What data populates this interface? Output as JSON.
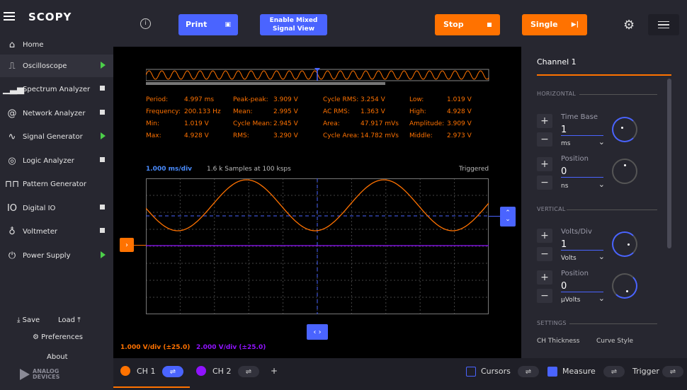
{
  "app": {
    "brand": "SCOPY",
    "footer_logo": "ANALOG\nDEVICES"
  },
  "sidebar": {
    "home": "Home",
    "items": [
      {
        "label": "Oscilloscope",
        "status": "running"
      },
      {
        "label": "Spectrum Analyzer",
        "status": "stopped"
      },
      {
        "label": "Network Analyzer",
        "status": "stopped"
      },
      {
        "label": "Signal Generator",
        "status": "running"
      },
      {
        "label": "Logic Analyzer",
        "status": "stopped"
      },
      {
        "label": "Pattern Generator",
        "status": "none"
      },
      {
        "label": "Digital IO",
        "status": "stopped"
      },
      {
        "label": "Voltmeter",
        "status": "stopped"
      },
      {
        "label": "Power Supply",
        "status": "running"
      }
    ],
    "save": "Save",
    "load": "Load",
    "preferences": "Preferences",
    "about": "About"
  },
  "toolbar": {
    "print": "Print",
    "mixed_view_line1": "Enable Mixed",
    "mixed_view_line2": "Signal View",
    "stop": "Stop",
    "single": "Single"
  },
  "measurements": [
    [
      "Period:",
      "4.997 ms",
      "Peak-peak:",
      "3.909 V",
      "Cycle RMS:",
      "3.254 V",
      "Low:",
      "1.019 V"
    ],
    [
      "Frequency:",
      "200.133 Hz",
      "Mean:",
      "2.995 V",
      "AC RMS:",
      "1.363 V",
      "High:",
      "4.928 V"
    ],
    [
      "Min:",
      "1.019 V",
      "Cycle Mean:",
      "2.945 V",
      "Area:",
      "47.917 mVs",
      "Amplitude:",
      "3.909 V"
    ],
    [
      "Max:",
      "4.928 V",
      "RMS:",
      "3.290 V",
      "Cycle Area:",
      "14.782 mVs",
      "Middle:",
      "2.973 V"
    ]
  ],
  "plot": {
    "time_div": "1.000 ms/div",
    "samples": "1.6 k Samples at 100 ksps",
    "status": "Triggered",
    "ch1_scale": "1.000 V/div (±25.0)",
    "ch2_scale": "2.000 V/div (±25.0)"
  },
  "panel": {
    "title": "Channel 1",
    "horizontal": "HORIZONTAL",
    "timebase_label": "Time Base",
    "timebase_value": "1",
    "timebase_unit": "ms",
    "hpos_label": "Position",
    "hpos_value": "0",
    "hpos_unit": "ns",
    "vertical": "VERTICAL",
    "vdiv_label": "Volts/Div",
    "vdiv_value": "1",
    "vdiv_unit": "Volts",
    "vpos_label": "Position",
    "vpos_value": "0",
    "vpos_unit": "μVolts",
    "settings": "SETTINGS",
    "ch_thickness": "CH Thickness",
    "curve_style": "Curve Style"
  },
  "bottom": {
    "ch1": "CH 1",
    "ch2": "CH 2",
    "add": "+",
    "cursors": "Cursors",
    "measure": "Measure",
    "trigger": "Trigger"
  },
  "colors": {
    "ch1": "#ff7200",
    "ch2": "#9013fe",
    "accent": "#4a64ff"
  }
}
